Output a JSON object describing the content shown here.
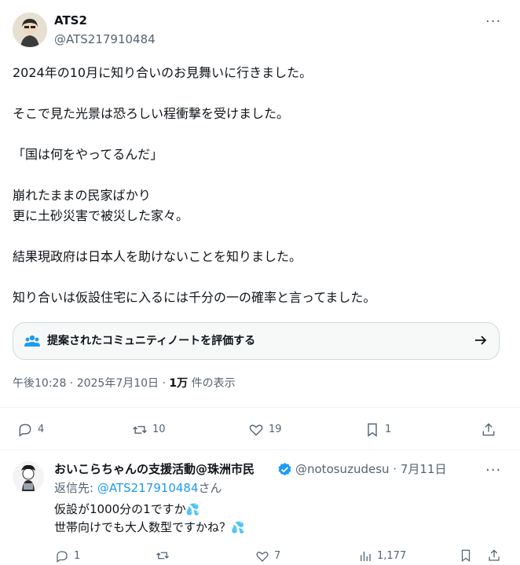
{
  "tweet": {
    "display_name": "ATS2",
    "handle": "@ATS217910484",
    "more_label": "···",
    "lines": [
      "2024年の10月に知り合いのお見舞いに行きました。",
      "",
      "そこで見た光景は恐ろしい程衝撃を受けました。",
      "",
      "「国は何をやってるんだ」",
      "",
      "崩れたままの民家ばかり",
      "更に土砂災害で被災した家々。",
      "",
      "結果現政府は日本人を助けないことを知りました。",
      "",
      "知り合いは仮設住宅に入るには千分の一の確率と言ってました。"
    ],
    "community_note_label": "提案されたコミュニティノートを評価する",
    "timestamp": "午後10:28 · 2025年7月10日 · ",
    "views_count": "1万",
    "views_label": " 件の表示",
    "actions": {
      "replies": "4",
      "retweets": "10",
      "likes": "19",
      "bookmarks": "1"
    }
  },
  "reply": {
    "display_name": "おいこらちゃんの支援活動@珠洲市民",
    "handle_time": "@notosuzudesu · 7月11日",
    "more_label": "···",
    "reply_prefix": "返信先: ",
    "reply_to_handle": "@ATS217910484",
    "reply_suffix": "さん",
    "line1": "仮設が1000分の1ですか",
    "line2": "世帯向けでも大人数型ですかね？",
    "actions": {
      "replies": "1",
      "retweets": "",
      "likes": "7",
      "views": "1,177"
    }
  },
  "colors": {
    "accent": "#1d9bf0",
    "secondary_text": "#536471",
    "border": "#cfd9de"
  }
}
